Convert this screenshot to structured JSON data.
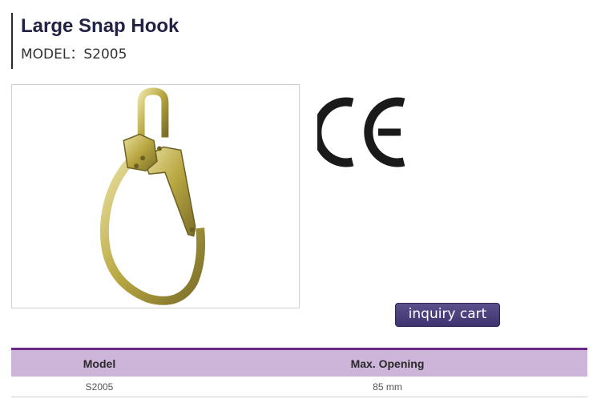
{
  "product": {
    "title": "Large Snap Hook",
    "model_label": "MODEL：S2005"
  },
  "image": {
    "icon": "snap-hook-photo"
  },
  "certification": {
    "icon": "ce-mark-icon"
  },
  "actions": {
    "inquiry_label": "inquiry cart"
  },
  "spec_table": {
    "headers": [
      "Model",
      "Max. Opening"
    ],
    "rows": [
      [
        "S2005",
        "85 mm"
      ]
    ]
  },
  "colors": {
    "header_bg": "#cdb4d9",
    "header_border": "#6b2a86",
    "button_bg": "#4b3f7e"
  }
}
